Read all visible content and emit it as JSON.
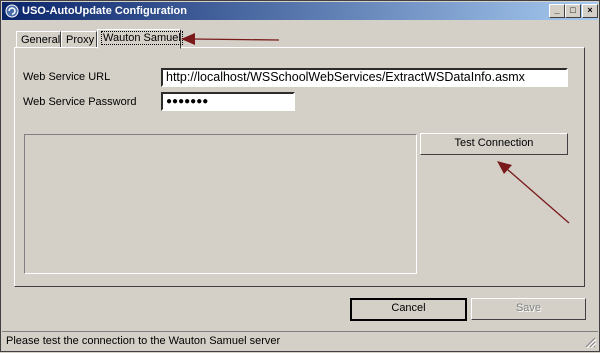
{
  "window": {
    "title": "USO-AutoUpdate Configuration",
    "controls": {
      "minimize": "_",
      "maximize": "□",
      "close": "×"
    }
  },
  "tabs": [
    {
      "label": "General"
    },
    {
      "label": "Proxy"
    },
    {
      "label": "Wauton Samuel",
      "active": true
    }
  ],
  "form": {
    "url_label": "Web Service URL",
    "url_value": "http://localhost/WSSchoolWebServices/ExtractWSDataInfo.asmx",
    "password_label": "Web Service Password",
    "password_value": "●●●●●●●"
  },
  "buttons": {
    "test": "Test Connection",
    "cancel": "Cancel",
    "save": "Save"
  },
  "status": {
    "text": "Please test the connection to the Wauton Samuel server"
  },
  "colors": {
    "annotation_arrow": "#7a1a1a",
    "titlebar_start": "#0a246a",
    "titlebar_end": "#a6caf0"
  }
}
